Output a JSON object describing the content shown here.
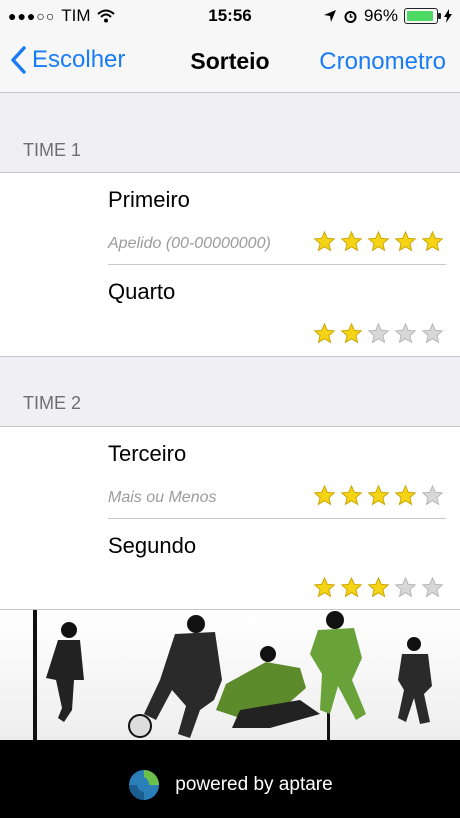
{
  "status_bar": {
    "carrier": "TIM",
    "time": "15:56",
    "battery": "96%"
  },
  "navbar": {
    "back_label": "Escolher",
    "title": "Sorteio",
    "right_label": "Cronometro"
  },
  "sections": [
    {
      "header": "TIME 1",
      "rows": [
        {
          "name": "Primeiro",
          "subtitle": "Apelido (00-00000000)",
          "rating": 5
        },
        {
          "name": "Quarto",
          "subtitle": "",
          "rating": 2
        }
      ]
    },
    {
      "header": "TIME 2",
      "rows": [
        {
          "name": "Terceiro",
          "subtitle": "Mais ou Menos",
          "rating": 4
        },
        {
          "name": "Segundo",
          "subtitle": "",
          "rating": 3
        }
      ]
    }
  ],
  "footer": {
    "powered_text": "powered by aptare"
  },
  "colors": {
    "accent": "#1a7cf5",
    "star_on": "#f5d416",
    "star_off": "#d8d8d8",
    "battery": "#4cd964"
  }
}
